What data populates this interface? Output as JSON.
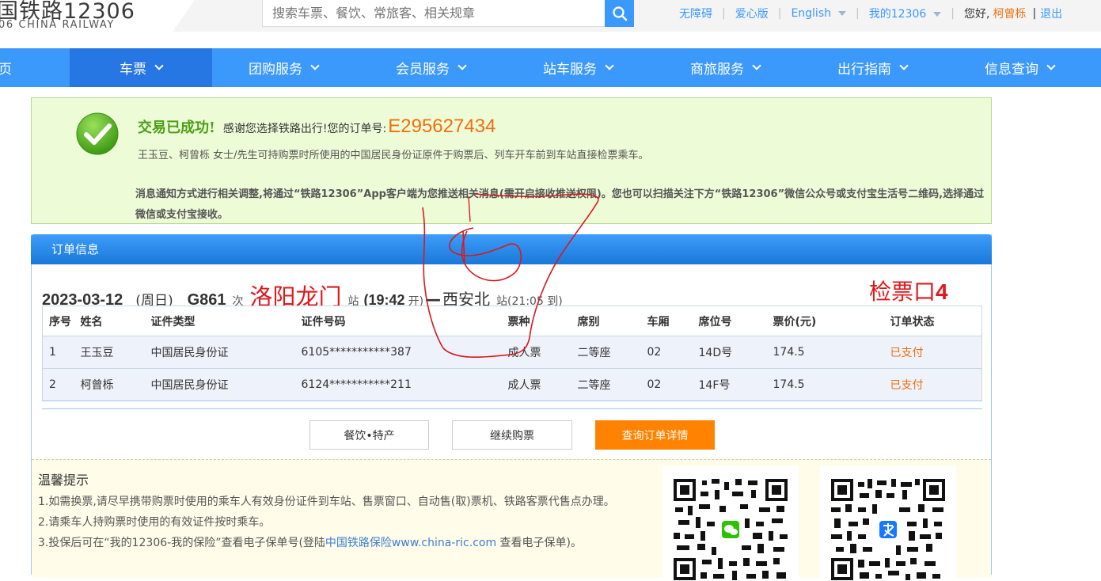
{
  "header": {
    "logo_cn": "国铁路12306",
    "logo_en": "06 CHINA RAILWAY",
    "search_placeholder": "搜索车票、餐饮、常旅客、相关规章",
    "links": {
      "accessibility": "无障碍",
      "care_mode": "爱心版",
      "language": "English",
      "my12306": "我的12306",
      "hello": "您好,",
      "username": "柯曾栎",
      "logout": "退出"
    }
  },
  "nav": {
    "items": [
      "页",
      "车票",
      "团购服务",
      "会员服务",
      "站车服务",
      "商旅服务",
      "出行指南",
      "信息查询"
    ]
  },
  "success": {
    "title": "交易已成功!",
    "thanks": "感谢您选择铁路出行!您的订单号:",
    "order_number": "E295627434",
    "line2": "王玉豆、柯曾栎 女士/先生可持购票时所使用的中国居民身份证原件于购票后、列车开车前到车站直接检票乘车。",
    "line3": "消息通知方式进行相关调整,将通过“铁路12306”App客户端为您推送相关消息(需开启接收推送权限)。您也可以扫描关注下方“铁路12306”微信公众号或支付宝生活号二维码,选择通过微信或支付宝接收。"
  },
  "order": {
    "header": "订单信息",
    "date": "2023-03-12",
    "weekday": "(周日)",
    "train": "G861",
    "train_suffix": "次",
    "from_station": "洛阳龙门",
    "station_suffix": "站",
    "depart_open": "(",
    "depart_time": "19:42",
    "depart_suffix": "开)",
    "dash": "—",
    "to_station": "西安北",
    "to_suffix": "站",
    "arrive": "(21:05 到)",
    "gate": "检票口",
    "gate_number": "4",
    "columns": [
      "序号",
      "姓名",
      "证件类型",
      "证件号码",
      "票种",
      "席别",
      "车厢",
      "席位号",
      "票价(元)",
      "订单状态"
    ],
    "rows": [
      [
        "1",
        "王玉豆",
        "中国居民身份证",
        "6105***********387",
        "成人票",
        "二等座",
        "02",
        "14D号",
        "174.5",
        "已支付"
      ],
      [
        "2",
        "柯曾栎",
        "中国居民身份证",
        "6124***********211",
        "成人票",
        "二等座",
        "02",
        "14F号",
        "174.5",
        "已支付"
      ]
    ],
    "buttons": {
      "food": "餐饮•特产",
      "continue": "继续购票",
      "details": "查询订单详情"
    }
  },
  "tips": {
    "title": "温馨提示",
    "item1": "1.如需换票,请尽早携带购票时使用的乘车人有效身份证件到车站、售票窗口、自动售(取)票机、铁路客票代售点办理。",
    "item2": "2.请乘车人持购票时使用的有效证件按时乘车。",
    "item3_pre": "3.投保后可在“我的12306-我的保险”查看电子保单号(登陆",
    "item3_link": "中国铁路保险www.china-ric.com",
    "item3_post": " 查看电子保单)。"
  },
  "colors": {
    "brand_blue": "#3b99fc",
    "nav_active": "#2676e3",
    "orange": "#ff8200",
    "success_green": "#4aa015",
    "annotation_red": "#e0171b"
  }
}
